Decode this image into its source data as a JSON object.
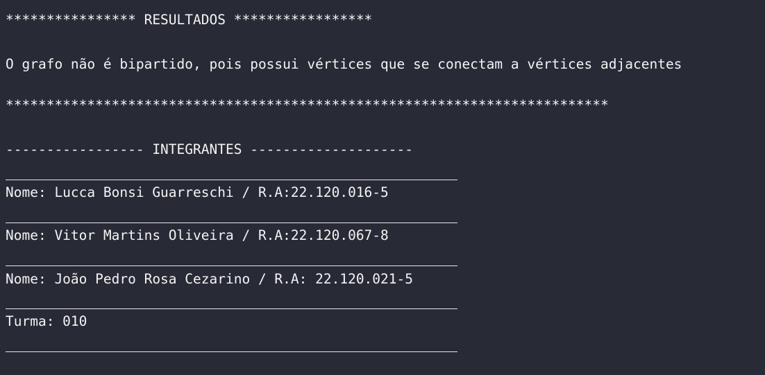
{
  "terminal": {
    "results_header": "**************** RESULTADOS *****************",
    "result_message": "O grafo não é bipartido, pois possui vértices que se conectam a vértices adjacentes",
    "results_footer": "**************************************************************************",
    "members_header": "----------------- INTEGRANTES --------------------",
    "members": [
      "Nome: Lucca Bonsi Guarreschi / R.A:22.120.016-5",
      "Nome: Vitor Martins Oliveira / R.A:22.120.067-8",
      "Nome: João Pedro Rosa Cezarino / R.A: 22.120.021-5"
    ],
    "class_line": "Turma: 010"
  }
}
